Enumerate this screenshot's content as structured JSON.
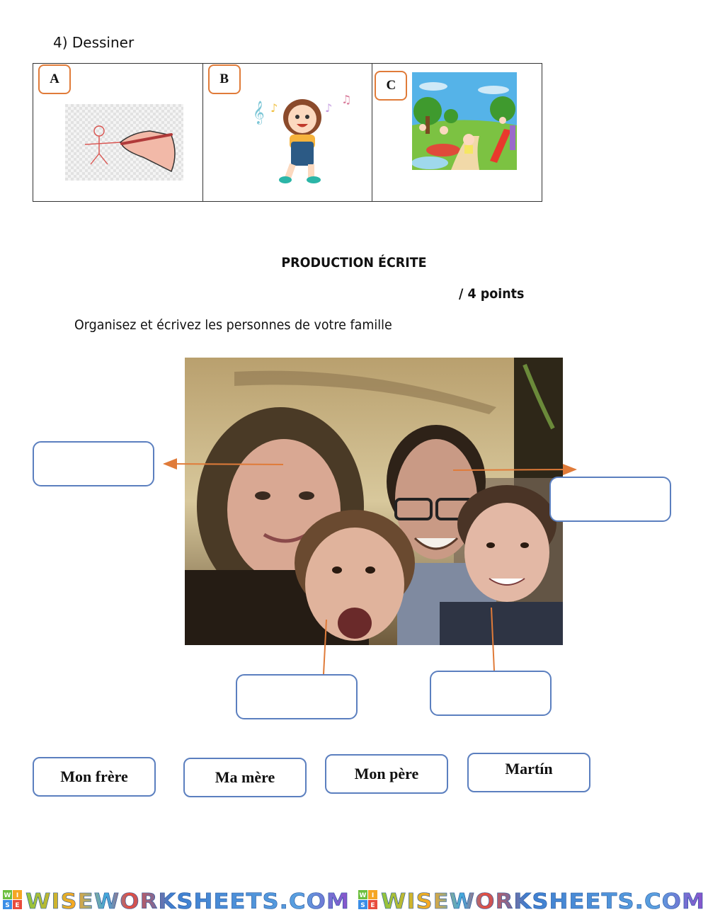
{
  "exercise": {
    "number_label": "4)  Dessiner",
    "options": [
      {
        "letter": "A",
        "image": "drawing-hand-stick-figure"
      },
      {
        "letter": "B",
        "image": "dancing-girl-music-notes"
      },
      {
        "letter": "C",
        "image": "children-playground"
      }
    ]
  },
  "production": {
    "title": "PRODUCTION ÉCRITE",
    "points": "/ 4 points",
    "instruction": "Organisez et écrivez les personnes de votre famille"
  },
  "photo": {
    "description": "family-selfie"
  },
  "answer_fields": [
    {
      "target": "mother",
      "value": ""
    },
    {
      "target": "father",
      "value": ""
    },
    {
      "target": "younger-child",
      "value": ""
    },
    {
      "target": "older-child",
      "value": ""
    }
  ],
  "word_bank": [
    {
      "label": "Mon frère"
    },
    {
      "label": "Ma mère"
    },
    {
      "label": "Mon père"
    },
    {
      "label": "Martín"
    }
  ],
  "colors": {
    "arrow": "#e07b39",
    "box_border": "#5b7fbf",
    "letter_border": "#e07b39"
  },
  "footer": {
    "logo_badge": [
      "W",
      "I",
      "S",
      "E"
    ],
    "logo_text": "WISEWORKSHEETS.COM"
  }
}
